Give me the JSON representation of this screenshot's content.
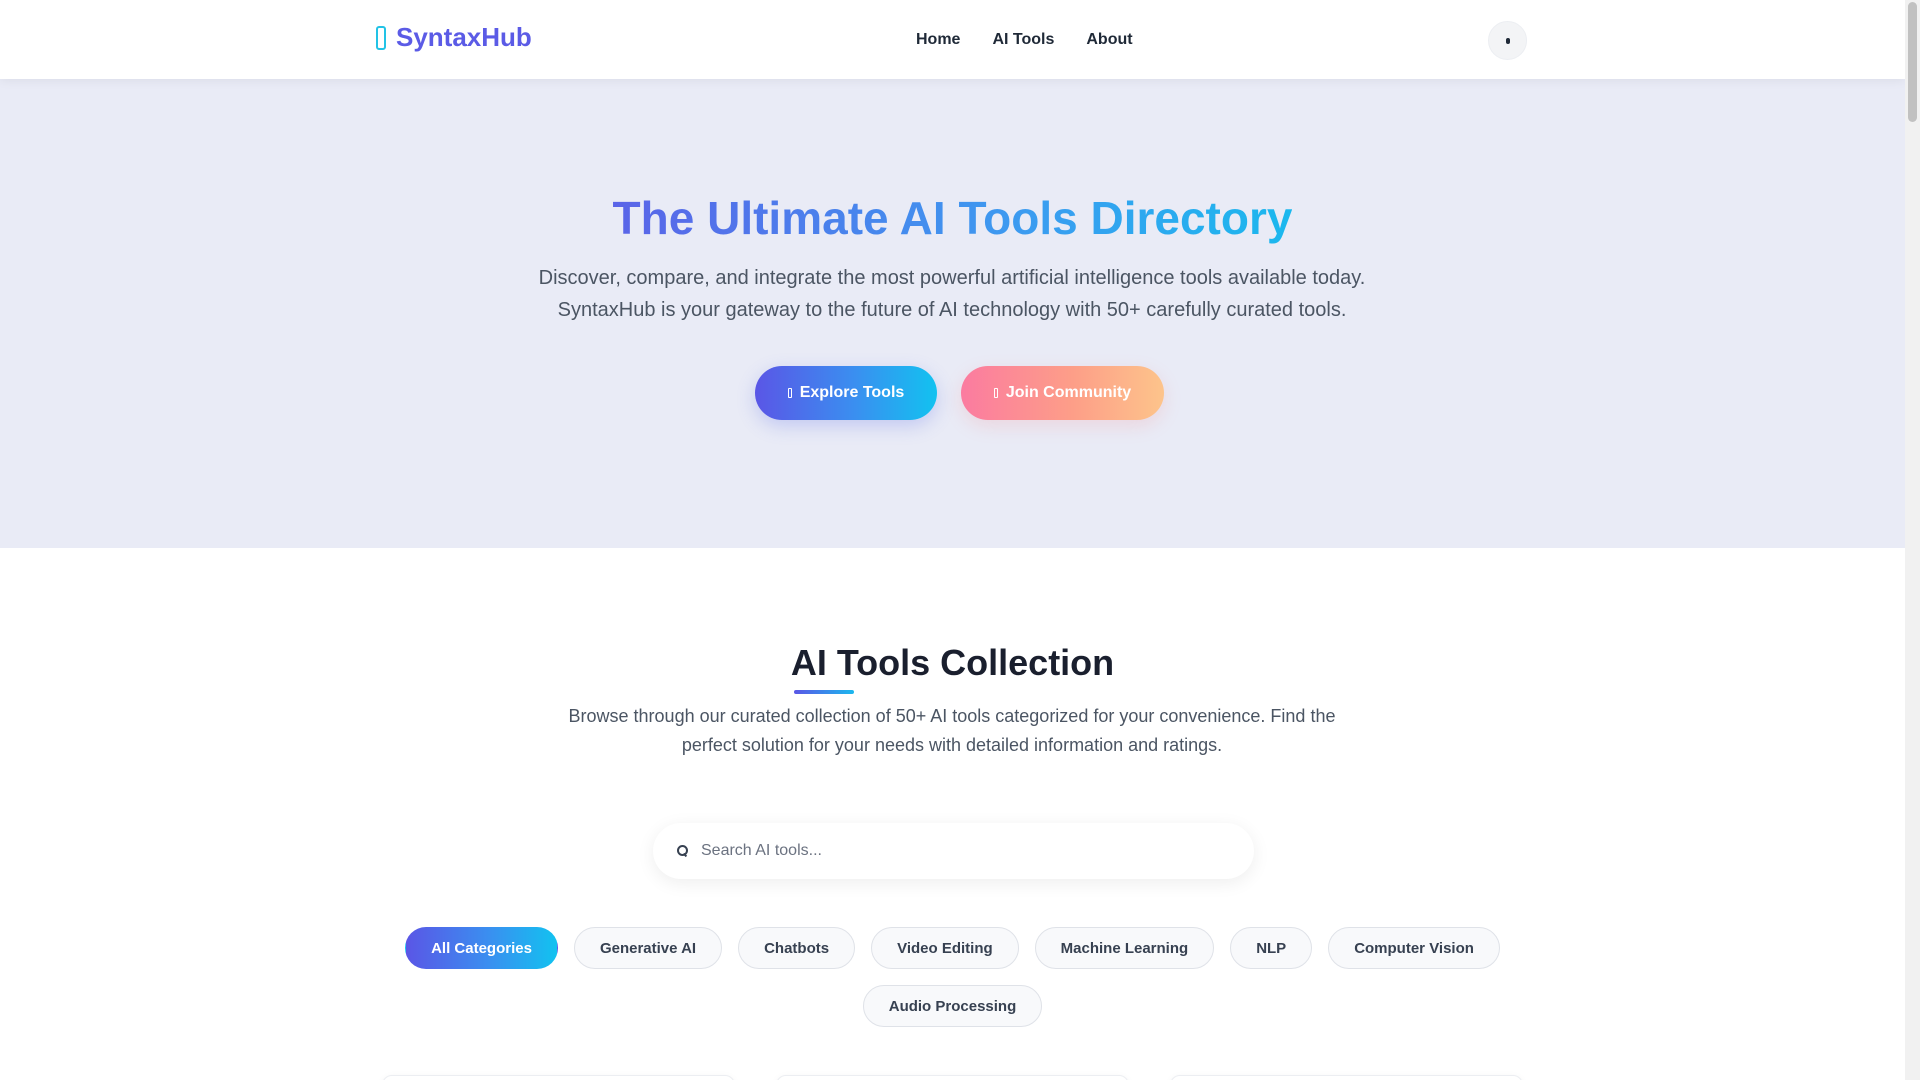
{
  "navbar": {
    "brand": "SyntaxHub",
    "brand_icon": "code-icon",
    "links": [
      "Home",
      "AI Tools",
      "About"
    ],
    "theme_toggle_icon": "moon-icon"
  },
  "hero": {
    "title": "The Ultimate AI Tools Directory",
    "subtitle": "Discover, compare, and integrate the most powerful artificial intelligence tools available today. SyntaxHub is your gateway to the future of AI technology with 50+ carefully curated tools.",
    "primary_button": "Explore Tools",
    "primary_button_icon": "compass-icon",
    "secondary_button": "Join Community",
    "secondary_button_icon": "users-icon"
  },
  "collection": {
    "title": "AI Tools Collection",
    "subtitle": "Browse through our curated collection of 50+ AI tools categorized for your convenience. Find the perfect solution for your needs with detailed information and ratings.",
    "search_placeholder": "Search AI tools...",
    "categories": [
      "All Categories",
      "Generative AI",
      "Chatbots",
      "Video Editing",
      "Machine Learning",
      "NLP",
      "Computer Vision",
      "Audio Processing"
    ],
    "active_category": "All Categories"
  },
  "colors": {
    "brand": "#5b5be6",
    "accent_gradient_start": "#5a56e6",
    "accent_gradient_end": "#12c2f0",
    "secondary_gradient_start": "#fb7ba0",
    "secondary_gradient_end": "#fdc48b",
    "hero_background": "#e9ebf6"
  }
}
